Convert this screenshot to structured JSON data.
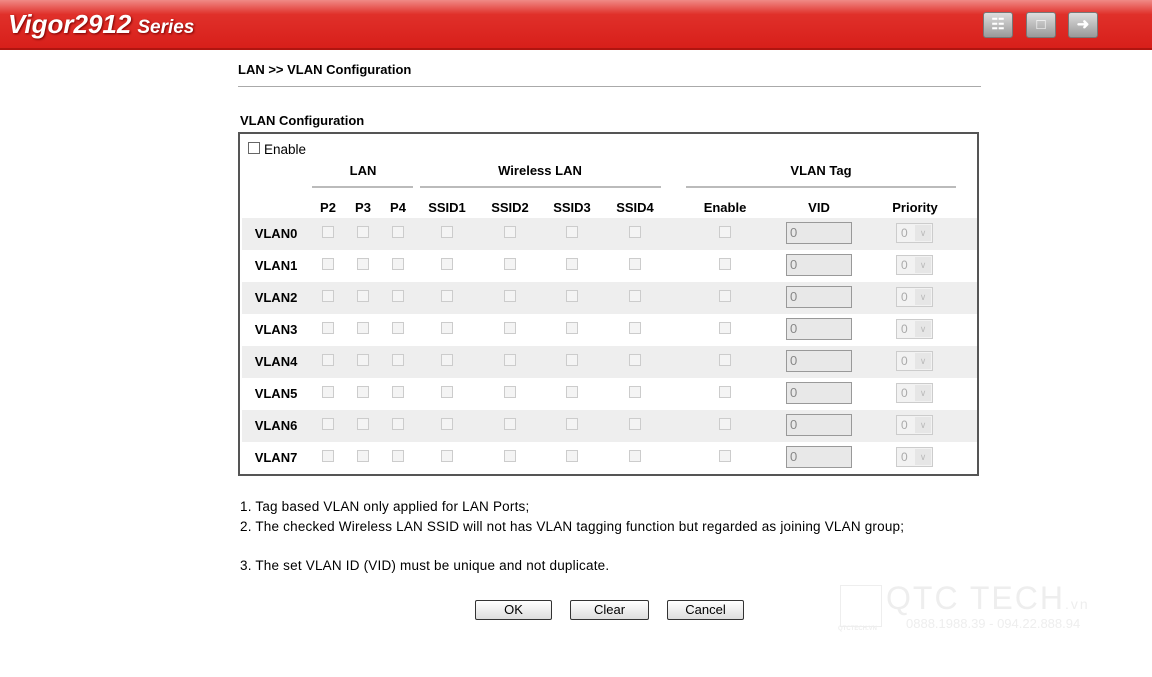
{
  "header": {
    "brand": "Vigor2912",
    "series": "Series",
    "icons": [
      "equalizer-icon",
      "save-icon",
      "logout-icon"
    ]
  },
  "breadcrumb": "LAN >> VLAN Configuration",
  "section_title": "VLAN Configuration",
  "enable_label": "Enable",
  "enable_checked": false,
  "groups": {
    "lan": "LAN",
    "wlan": "Wireless LAN",
    "tag": "VLAN Tag"
  },
  "columns": [
    "P2",
    "P3",
    "P4",
    "SSID1",
    "SSID2",
    "SSID3",
    "SSID4",
    "Enable",
    "VID",
    "Priority"
  ],
  "rows": [
    {
      "name": "VLAN0",
      "vid": "0",
      "priority": "0"
    },
    {
      "name": "VLAN1",
      "vid": "0",
      "priority": "0"
    },
    {
      "name": "VLAN2",
      "vid": "0",
      "priority": "0"
    },
    {
      "name": "VLAN3",
      "vid": "0",
      "priority": "0"
    },
    {
      "name": "VLAN4",
      "vid": "0",
      "priority": "0"
    },
    {
      "name": "VLAN5",
      "vid": "0",
      "priority": "0"
    },
    {
      "name": "VLAN6",
      "vid": "0",
      "priority": "0"
    },
    {
      "name": "VLAN7",
      "vid": "0",
      "priority": "0"
    }
  ],
  "notes": [
    "1. Tag based VLAN only applied for LAN Ports;",
    "2. The checked Wireless LAN SSID will not has VLAN tagging function but regarded as joining VLAN group;",
    "3. The set VLAN ID (VID) must be unique and not duplicate."
  ],
  "buttons": {
    "ok": "OK",
    "clear": "Clear",
    "cancel": "Cancel"
  },
  "watermark": {
    "brand": "QTC TECH",
    "suffix": ".vn",
    "phone": "0888.1988.39 - 094.22.888.94",
    "qr_label": "QTCTECH.VN"
  }
}
